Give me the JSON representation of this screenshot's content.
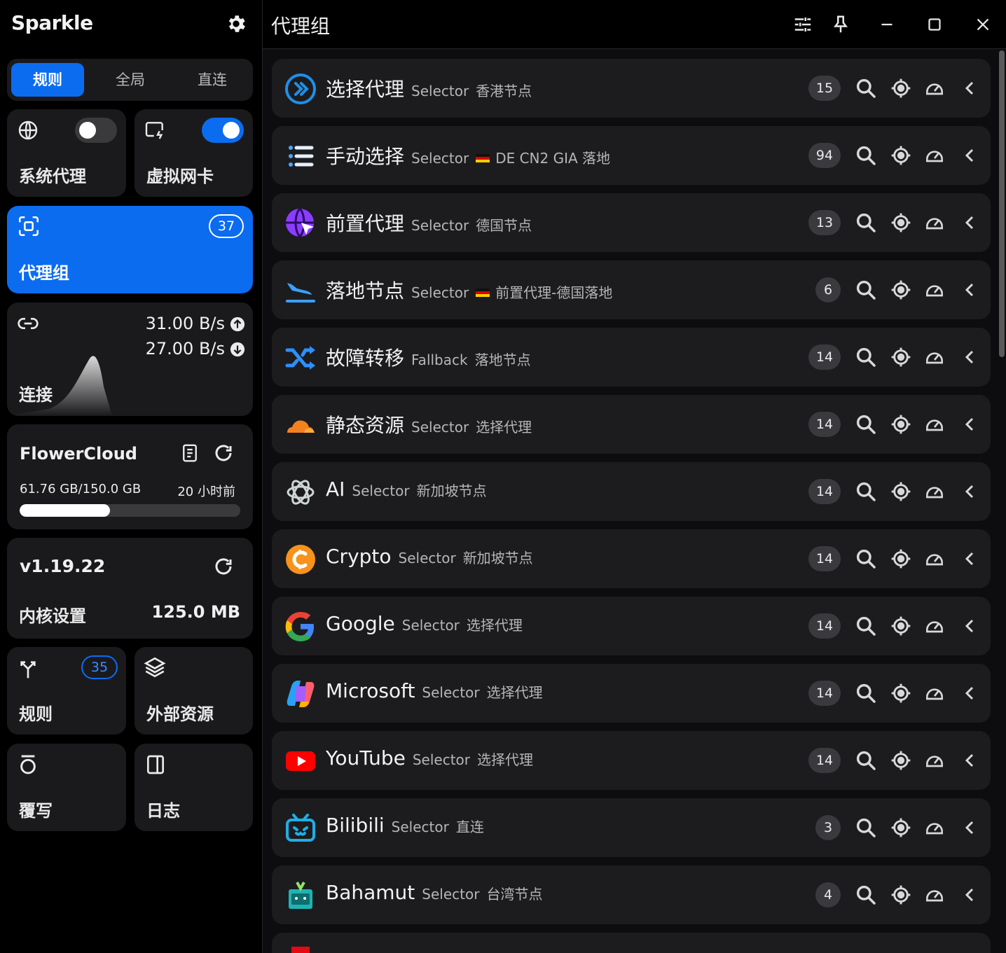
{
  "app": {
    "title": "Sparkle"
  },
  "mode": {
    "tabs": [
      "规则",
      "全局",
      "直连"
    ],
    "active": 0
  },
  "cards": {
    "system_proxy": {
      "label": "系统代理",
      "enabled": false
    },
    "tun": {
      "label": "虚拟网卡",
      "enabled": true
    },
    "proxy_groups": {
      "label": "代理组",
      "count": "37"
    },
    "connections": {
      "label": "连接",
      "upload": "31.00 B/s",
      "download": "27.00 B/s"
    },
    "subscription": {
      "name": "FlowerCloud",
      "usage": "61.76 GB/150.0 GB",
      "updated": "20 小时前",
      "used_fraction": 0.41
    },
    "core": {
      "version": "v1.19.22",
      "label": "内核设置",
      "memory": "125.0 MB"
    },
    "rules": {
      "label": "规则",
      "count": "35"
    },
    "resources": {
      "label": "外部资源"
    },
    "override": {
      "label": "覆写"
    },
    "logs": {
      "label": "日志"
    }
  },
  "main": {
    "title": "代理组"
  },
  "groups": [
    {
      "name": "选择代理",
      "type": "Selector",
      "current": "香港节点",
      "count": "15",
      "icon": "double-chevron-icon",
      "flag": false
    },
    {
      "name": "手动选择",
      "type": "Selector",
      "current": "DE CN2 GIA 落地",
      "count": "94",
      "icon": "list-icon",
      "flag": true
    },
    {
      "name": "前置代理",
      "type": "Selector",
      "current": "德国节点",
      "count": "13",
      "icon": "globe-cursor-icon",
      "flag": false
    },
    {
      "name": "落地节点",
      "type": "Selector",
      "current": "前置代理-德国落地",
      "count": "6",
      "icon": "plane-landing-icon",
      "flag": true
    },
    {
      "name": "故障转移",
      "type": "Fallback",
      "current": "落地节点",
      "count": "14",
      "icon": "shuffle-icon",
      "flag": false
    },
    {
      "name": "静态资源",
      "type": "Selector",
      "current": "选择代理",
      "count": "14",
      "icon": "cloudflare-icon",
      "flag": false
    },
    {
      "name": "AI",
      "type": "Selector",
      "current": "新加坡节点",
      "count": "14",
      "icon": "openai-icon",
      "flag": false
    },
    {
      "name": "Crypto",
      "type": "Selector",
      "current": "新加坡节点",
      "count": "14",
      "icon": "crypto-icon",
      "flag": false
    },
    {
      "name": "Google",
      "type": "Selector",
      "current": "选择代理",
      "count": "14",
      "icon": "google-icon",
      "flag": false
    },
    {
      "name": "Microsoft",
      "type": "Selector",
      "current": "选择代理",
      "count": "14",
      "icon": "copilot-icon",
      "flag": false
    },
    {
      "name": "YouTube",
      "type": "Selector",
      "current": "选择代理",
      "count": "14",
      "icon": "youtube-icon",
      "flag": false
    },
    {
      "name": "Bilibili",
      "type": "Selector",
      "current": "直连",
      "count": "3",
      "icon": "bilibili-icon",
      "flag": false
    },
    {
      "name": "Bahamut",
      "type": "Selector",
      "current": "台湾节点",
      "count": "4",
      "icon": "bahamut-icon",
      "flag": false
    }
  ],
  "colors": {
    "accent": "#0b6cf0",
    "card": "#1a1a1d",
    "row": "#1c1c1f"
  }
}
